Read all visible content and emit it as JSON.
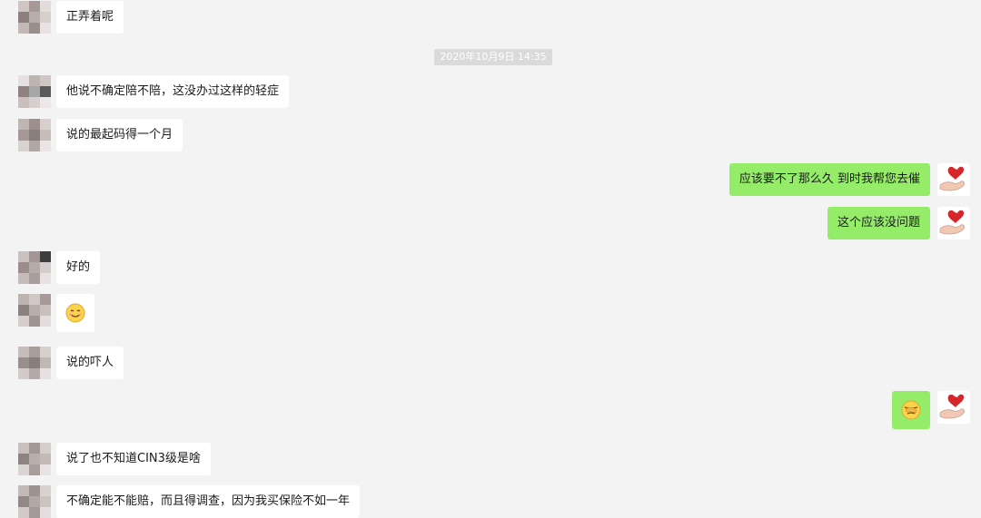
{
  "timestamp": "2020年10月9日 14:35",
  "messages": [
    {
      "side": "left",
      "text": "正弄着呢"
    },
    {
      "side": "left",
      "text": "他说不确定陪不陪，这没办过这样的轻症"
    },
    {
      "side": "left",
      "text": "说的最起码得一个月"
    },
    {
      "side": "right",
      "text": "应该要不了那么久  到时我帮您去催"
    },
    {
      "side": "right",
      "text": "这个应该没问题"
    },
    {
      "side": "left",
      "text": "好的"
    },
    {
      "side": "left",
      "emoji": "smile-emoji"
    },
    {
      "side": "left",
      "text": "说的吓人"
    },
    {
      "side": "right",
      "emoji": "facepalm-emoji"
    },
    {
      "side": "left",
      "text": "说了也不知道CIN3级是啥"
    },
    {
      "side": "left",
      "text": "不确定能不能赔，而且得调查，因为我买保险不如一年"
    }
  ],
  "colors": {
    "background": "#f3f3f3",
    "bubble_in": "#ffffff",
    "bubble_out": "#95ec69",
    "timestamp_bg": "#dadada"
  }
}
